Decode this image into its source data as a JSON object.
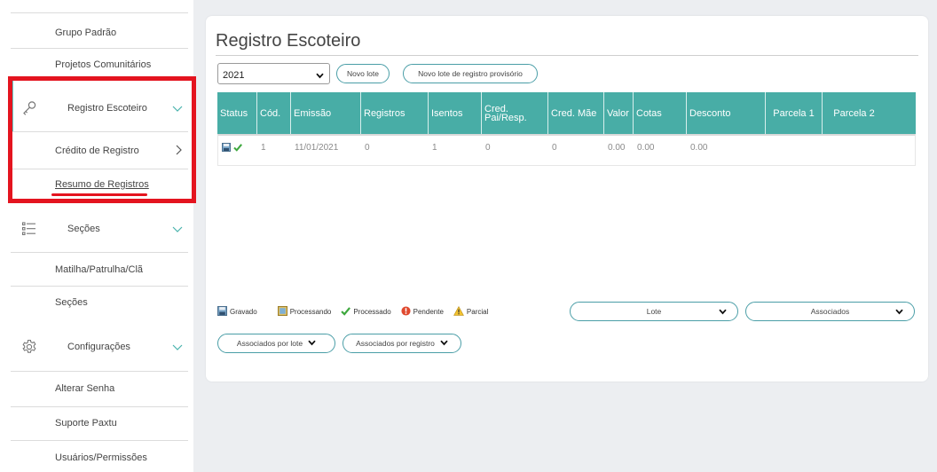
{
  "sidebar": {
    "grupo_padrao": "Grupo Padrão",
    "projetos": "Projetos Comunitários",
    "registro_escoteiro": "Registro Escoteiro",
    "credito_registro": "Crédito de Registro",
    "resumo_registros": "Resumo de Registros",
    "secoes_group": "Seções",
    "matilha": "Matilha/Patrulha/Clã",
    "secoes_item": "Seções",
    "configuracoes": "Configurações",
    "alterar_senha": "Alterar Senha",
    "suporte": "Suporte Paxtu",
    "usuarios": "Usuários/Permissões"
  },
  "main": {
    "title": "Registro Escoteiro",
    "year_select": "2021",
    "novo_lote": "Novo lote",
    "novo_lote_provisorio": "Novo lote de registro provisório"
  },
  "table": {
    "columns": [
      "Status",
      "Cód.",
      "Emissão",
      "Registros",
      "Isentos",
      "Cred. Pai/Resp.",
      "Cred. Mãe",
      "Valor",
      "Cotas",
      "Desconto",
      "Parcela 1",
      "Parcela 2"
    ],
    "rows": [
      {
        "cod": "1",
        "emissao": "11/01/2021",
        "registros": "0",
        "isentos": "1",
        "cred_pai": "0",
        "cred_mae": "0",
        "valor": "0.00",
        "cotas": "0.00",
        "desconto": "0.00",
        "parcela1": "",
        "parcela2": ""
      }
    ]
  },
  "legend": {
    "gravado": "Gravado",
    "processando": "Processando",
    "processado": "Processado",
    "pendente": "Pendente",
    "parcial": "Parcial"
  },
  "filters": {
    "lote": "Lote",
    "associados": "Associados",
    "associados_por_lote": "Associados por lote",
    "associados_por_registro": "Associados por registro"
  },
  "colors": {
    "teal_header": "#48ada6",
    "highlight_red": "#e4141f",
    "active_bar": "#5bd0cc"
  }
}
